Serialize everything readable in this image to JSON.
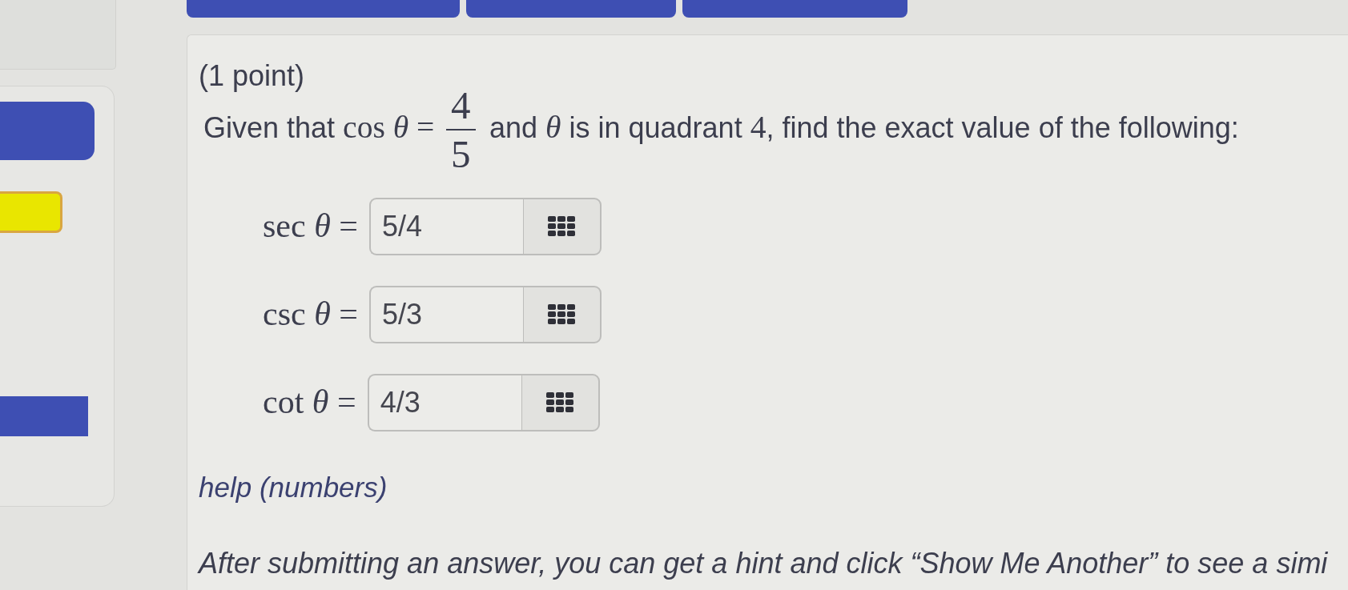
{
  "sidebar": {
    "items": [
      {
        "color": "#3e4fb3"
      },
      {
        "color": "#e9e600"
      },
      {
        "color": "#3e4fb3"
      }
    ]
  },
  "problem": {
    "points": "(1 point)",
    "statement": [
      {
        "kind": "text",
        "text": "Given that "
      },
      {
        "kind": "math",
        "text": "cos *θ* ="
      },
      {
        "kind": "fraction",
        "numerator": "4",
        "denominator": "5"
      },
      {
        "kind": "text",
        "text": " and "
      },
      {
        "kind": "variable",
        "text": "θ"
      },
      {
        "kind": "text",
        "text": " is in quadrant "
      },
      {
        "kind": "math",
        "text": "4"
      },
      {
        "kind": "text",
        "text": ", find the exact value of the following:"
      }
    ],
    "answers": [
      {
        "label": "sec *θ* =",
        "value": "5/4"
      },
      {
        "label": "csc *θ* =",
        "value": "5/3"
      },
      {
        "label": "cot *θ* =",
        "value": "4/3"
      }
    ],
    "help_link": "help (numbers)",
    "note": "After submitting an answer, you can get a hint and click “Show Me Another” to see a simi"
  }
}
